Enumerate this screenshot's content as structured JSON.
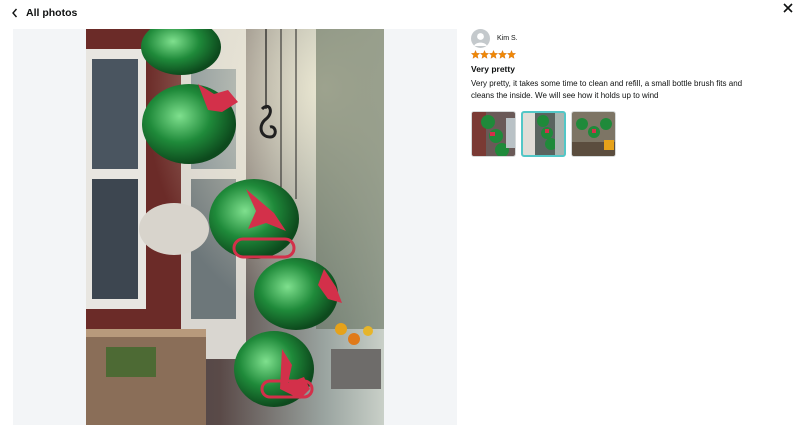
{
  "header": {
    "back_label": "All photos"
  },
  "review": {
    "author": "Kim S.",
    "rating": 5,
    "rating_max": 5,
    "title": "Very pretty",
    "body": "Very pretty, it takes some time to clean and refill, a small bottle brush fits and cleans the inside. We will see how it holds up to wind"
  },
  "thumbnails": [
    {
      "name": "thumbnail-1",
      "selected": false
    },
    {
      "name": "thumbnail-2",
      "selected": true
    },
    {
      "name": "thumbnail-3",
      "selected": false
    }
  ],
  "colors": {
    "star": "#f08804",
    "accent_border": "#52c7c7",
    "feeder_green": "#1f8a3a",
    "feeder_red": "#d3304a"
  },
  "icons": [
    "chevron-left-icon",
    "close-icon",
    "user-avatar-icon",
    "star-icon"
  ]
}
